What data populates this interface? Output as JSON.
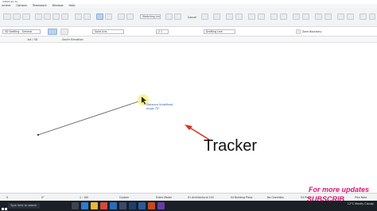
{
  "window": {
    "title": "dd620.ad.3e"
  },
  "menu": {
    "items": [
      "ument",
      "Options",
      "Teamwork",
      "Window",
      "Help"
    ]
  },
  "toolbar": {
    "field_a": "Sketching Lines",
    "field_b": "Solid Line",
    "field_c": "0.0",
    "field_d": "Drafting Line",
    "field_e": "Overwrite",
    "cancel": "Cancel",
    "override": "Zone Boundary"
  },
  "toolbar2": {
    "layer": "3D Drafting - General",
    "linetype": "Solid Line",
    "pen": "2 1",
    "category": "Drafting Line",
    "checkbox": "Zone Boundary"
  },
  "view": {
    "tab1": "1st / 3D",
    "tab2": "South Elevation"
  },
  "tracker": {
    "distance": "Distance  Undefined",
    "angle": "Angle       75°"
  },
  "annotation": {
    "label": "Tracker"
  },
  "status": [
    "0",
    "0°",
    "1 : 100",
    "Custom",
    "Entire Model",
    "01 Architectural 100",
    "04 Building Plans",
    "No Overrides",
    "04 Plans",
    "Plan Note"
  ],
  "taskbar": {
    "search": "Type here to search",
    "time": "12°C  Mostly Cloudy"
  },
  "watermark": {
    "line1": "For more updates",
    "line2": "SUBSCRIB"
  }
}
